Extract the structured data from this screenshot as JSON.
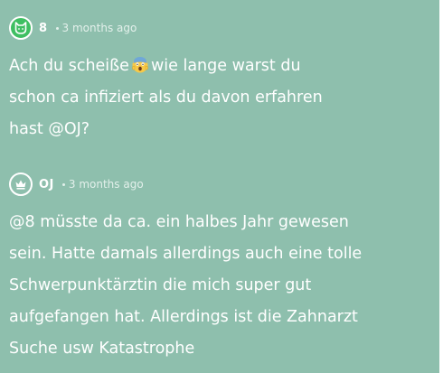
{
  "comments": [
    {
      "username": "8",
      "avatar_icon": "cat-face-icon",
      "avatar_color": "#3fbf62",
      "timestamp": "3 months ago",
      "lines": [
        {
          "before": "Ach du scheiße",
          "emoji": "screaming-face-emoji",
          "after": "wie lange warst du"
        },
        "schon ca infiziert als du davon erfahren",
        "hast @OJ?"
      ]
    },
    {
      "username": "OJ",
      "avatar_icon": "crown-icon",
      "avatar_color": "#8ebfad",
      "timestamp": "3 months ago",
      "lines": [
        "@8 müsste da ca. ein halbes Jahr gewesen",
        "sein. Hatte damals allerdings auch eine tolle",
        "Schwerpunktärztin die mich super gut",
        "aufgefangen hat. Allerdings ist die Zahnarzt",
        "Suche usw Katastrophe"
      ]
    }
  ],
  "colors": {
    "background": "#8ebfad",
    "text": "#ffffff",
    "meta_text": "#e3f0eb"
  }
}
